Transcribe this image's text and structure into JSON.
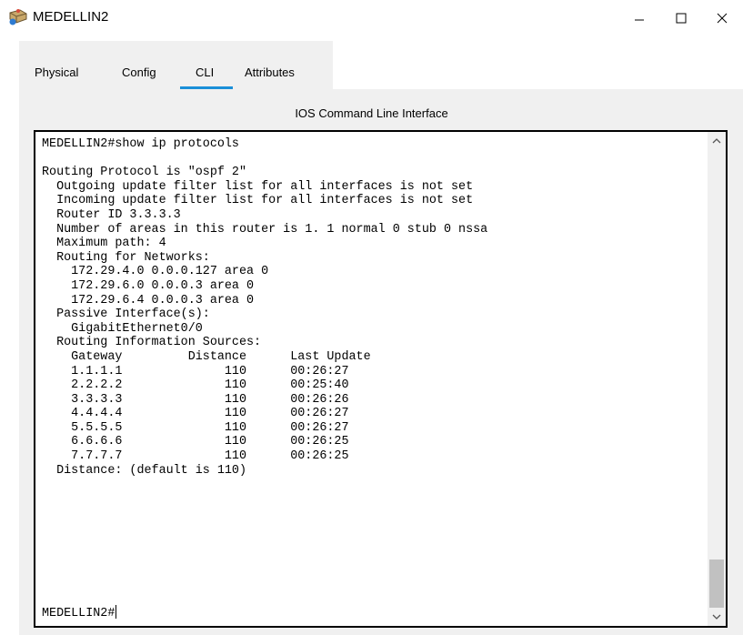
{
  "window": {
    "title": "MEDELLIN2",
    "icon": "router-icon"
  },
  "tabs": [
    {
      "label": "Physical",
      "active": false
    },
    {
      "label": "Config",
      "active": false
    },
    {
      "label": "CLI",
      "active": true
    },
    {
      "label": "Attributes",
      "active": false
    }
  ],
  "cli": {
    "section_title": "IOS Command Line Interface",
    "output": "MEDELLIN2#show ip protocols\n\nRouting Protocol is \"ospf 2\"\n  Outgoing update filter list for all interfaces is not set\n  Incoming update filter list for all interfaces is not set\n  Router ID 3.3.3.3\n  Number of areas in this router is 1. 1 normal 0 stub 0 nssa\n  Maximum path: 4\n  Routing for Networks:\n    172.29.4.0 0.0.0.127 area 0\n    172.29.6.0 0.0.0.3 area 0\n    172.29.6.4 0.0.0.3 area 0\n  Passive Interface(s):\n    GigabitEthernet0/0\n  Routing Information Sources:\n    Gateway         Distance      Last Update\n    1.1.1.1              110      00:26:27\n    2.2.2.2              110      00:25:40\n    3.3.3.3              110      00:26:26\n    4.4.4.4              110      00:26:27\n    5.5.5.5              110      00:26:27\n    6.6.6.6              110      00:26:25\n    7.7.7.7              110      00:26:25\n  Distance: (default is 110)",
    "prompt": "MEDELLIN2#"
  },
  "colors": {
    "tab_accent": "#1a8fd8",
    "panel_bg": "#f0f0f0"
  }
}
